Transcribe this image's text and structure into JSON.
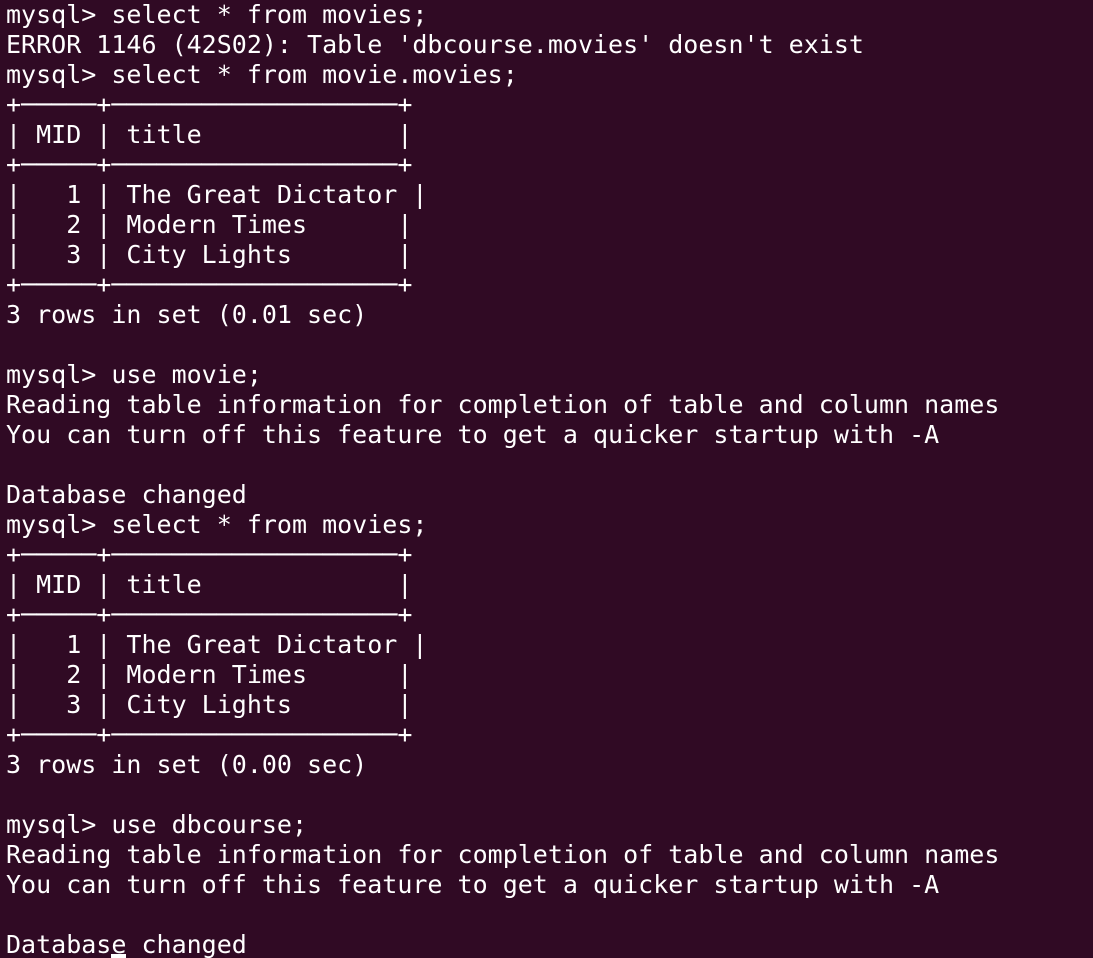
{
  "terminal": {
    "lines": [
      "mysql> select * from movies;",
      "ERROR 1146 (42S02): Table 'dbcourse.movies' doesn't exist",
      "mysql> select * from movie.movies;",
      "+─────+───────────────────+",
      "| MID | title             |",
      "+─────+───────────────────+",
      "|   1 | The Great Dictator |",
      "|   2 | Modern Times      |",
      "|   3 | City Lights       |",
      "+─────+───────────────────+",
      "3 rows in set (0.01 sec)",
      "",
      "mysql> use movie;",
      "Reading table information for completion of table and column names",
      "You can turn off this feature to get a quicker startup with -A",
      "",
      "Database changed",
      "mysql> select * from movies;",
      "+─────+───────────────────+",
      "| MID | title             |",
      "+─────+───────────────────+",
      "|   1 | The Great Dictator |",
      "|   2 | Modern Times      |",
      "|   3 | City Lights       |",
      "+─────+───────────────────+",
      "3 rows in set (0.00 sec)",
      "",
      "mysql> use dbcourse;",
      "Reading table information for completion of table and column names",
      "You can turn off this feature to get a quicker startup with -A",
      "",
      "Database changed"
    ]
  }
}
